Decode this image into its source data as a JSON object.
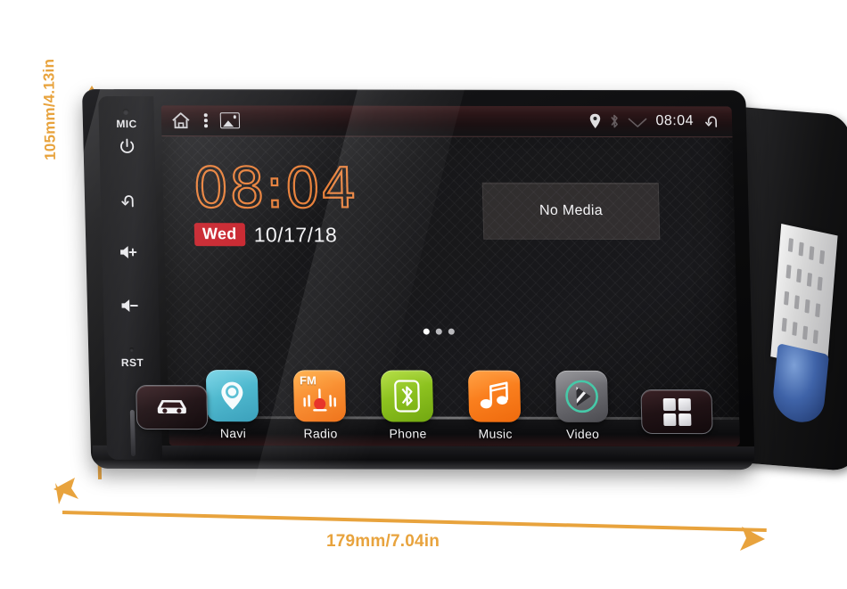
{
  "product": {
    "type": "car-head-unit-android",
    "accent_color": "#E8A33D",
    "clock_color": "#E8803A",
    "badge_color": "#C8232C"
  },
  "dimensions": {
    "height_label": "105mm/4.13in",
    "width_label": "179mm/7.04in"
  },
  "hardware_buttons": [
    {
      "key": "mic",
      "label": "MIC",
      "icon": "microphone-hole-icon"
    },
    {
      "key": "power",
      "label": "",
      "icon": "power-icon"
    },
    {
      "key": "back",
      "label": "",
      "icon": "back-arrow-icon"
    },
    {
      "key": "volup",
      "label": "",
      "icon": "volume-up-icon"
    },
    {
      "key": "voldn",
      "label": "",
      "icon": "volume-down-icon"
    },
    {
      "key": "reset",
      "label": "RST",
      "icon": "reset-pinhole-icon"
    }
  ],
  "statusbar": {
    "left_icons": [
      "home-icon",
      "overflow-menu-icon",
      "wallpaper-icon"
    ],
    "right_icons": [
      "location-pin-icon",
      "bluetooth-icon",
      "wifi-icon"
    ],
    "time": "08:04",
    "back_icon": "back-arrow-icon"
  },
  "clock_widget": {
    "time": "08:04",
    "day": "Wed",
    "date": "10/17/18"
  },
  "media_panel": {
    "text": "No Media"
  },
  "page_indicator": {
    "total": 3,
    "active": 1
  },
  "apps": [
    {
      "label": "Navi",
      "icon": "map-pin-icon",
      "style": "ic-navi",
      "tag": ""
    },
    {
      "label": "Radio",
      "icon": "fm-tuner-icon",
      "style": "ic-radio",
      "tag": "FM"
    },
    {
      "label": "Phone",
      "icon": "bluetooth-icon",
      "style": "ic-phone",
      "tag": ""
    },
    {
      "label": "Music",
      "icon": "music-note-icon",
      "style": "ic-music",
      "tag": ""
    },
    {
      "label": "Video",
      "icon": "video-play-icon",
      "style": "ic-video",
      "tag": ""
    }
  ],
  "corner_buttons": [
    {
      "key": "car",
      "icon": "car-icon",
      "label": ""
    },
    {
      "key": "apps",
      "icon": "app-grid-icon",
      "label": ""
    }
  ]
}
